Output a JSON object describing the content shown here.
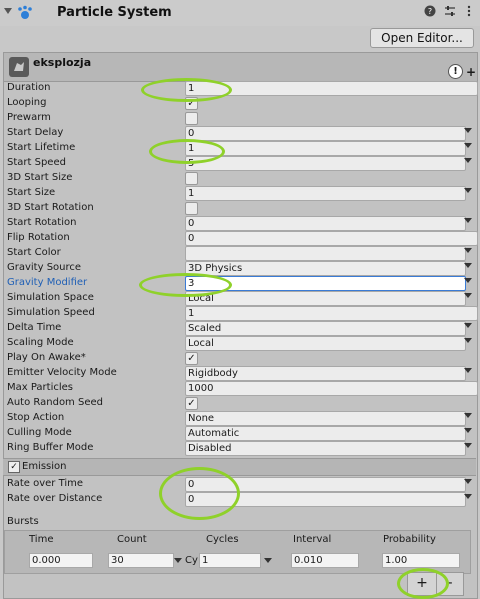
{
  "header": {
    "title": "Particle System",
    "help_icon": "help-icon",
    "settings_icon": "sliders-icon",
    "menu_icon": "kebab-icon"
  },
  "open_editor_label": "Open Editor...",
  "panel": {
    "name": "eksplozja"
  },
  "props": [
    {
      "label": "Duration",
      "value": "1",
      "kind": "field",
      "dropdown": false
    },
    {
      "label": "Looping",
      "checked": true,
      "kind": "check"
    },
    {
      "label": "Prewarm",
      "checked": false,
      "kind": "check"
    },
    {
      "label": "Start Delay",
      "value": "0",
      "kind": "field",
      "dropdown": true
    },
    {
      "label": "Start Lifetime",
      "value": "1",
      "kind": "field",
      "dropdown": true
    },
    {
      "label": "Start Speed",
      "value": "5",
      "kind": "field",
      "dropdown": true
    },
    {
      "label": "3D Start Size",
      "checked": false,
      "kind": "check"
    },
    {
      "label": "Start Size",
      "value": "1",
      "kind": "field",
      "dropdown": true
    },
    {
      "label": "3D Start Rotation",
      "checked": false,
      "kind": "check"
    },
    {
      "label": "Start Rotation",
      "value": "0",
      "kind": "field",
      "dropdown": true
    },
    {
      "label": "Flip Rotation",
      "value": "0",
      "kind": "field",
      "dropdown": false
    },
    {
      "label": "Start Color",
      "value": "",
      "kind": "color",
      "dropdown": true
    },
    {
      "label": "Gravity Source",
      "value": "3D Physics",
      "kind": "select"
    },
    {
      "label": "Gravity Modifier",
      "value": "3",
      "kind": "field",
      "dropdown": true,
      "active": true
    },
    {
      "label": "Simulation Space",
      "value": "Local",
      "kind": "select"
    },
    {
      "label": "Simulation Speed",
      "value": "1",
      "kind": "field",
      "dropdown": false
    },
    {
      "label": "Delta Time",
      "value": "Scaled",
      "kind": "select"
    },
    {
      "label": "Scaling Mode",
      "value": "Local",
      "kind": "select"
    },
    {
      "label": "Play On Awake*",
      "checked": true,
      "kind": "check"
    },
    {
      "label": "Emitter Velocity Mode",
      "value": "Rigidbody",
      "kind": "select"
    },
    {
      "label": "Max Particles",
      "value": "1000",
      "kind": "field",
      "dropdown": false
    },
    {
      "label": "Auto Random Seed",
      "checked": true,
      "kind": "check"
    },
    {
      "label": "Stop Action",
      "value": "None",
      "kind": "select"
    },
    {
      "label": "Culling Mode",
      "value": "Automatic",
      "kind": "select"
    },
    {
      "label": "Ring Buffer Mode",
      "value": "Disabled",
      "kind": "select"
    }
  ],
  "emission": {
    "title": "Emission",
    "rate_over_time_label": "Rate over Time",
    "rate_over_time": "0",
    "rate_over_distance_label": "Rate over Distance",
    "rate_over_distance": "0",
    "bursts_label": "Bursts",
    "columns": [
      "Time",
      "Count",
      "Cycles",
      "Interval",
      "Probability"
    ],
    "burst": {
      "time": "0.000",
      "count": "30",
      "cycles_mode": "Cy",
      "cycles": "1",
      "interval": "0.010",
      "probability": "1.00"
    },
    "plus": "+",
    "minus": "-"
  },
  "colors": {
    "highlight": "#8fd12a",
    "label_blue": "#1f5fb5"
  }
}
